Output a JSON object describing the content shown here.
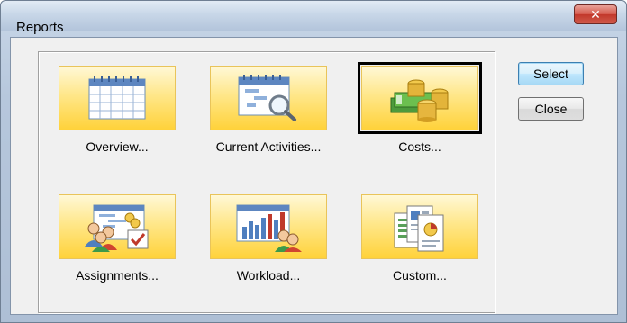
{
  "window": {
    "title": "Reports",
    "close_glyph": "✕"
  },
  "tiles": [
    {
      "label": "Overview...",
      "icon": "calendar-grid-icon"
    },
    {
      "label": "Current Activities...",
      "icon": "calendar-magnifier-icon"
    },
    {
      "label": "Costs...",
      "icon": "money-stacks-icon",
      "selected": true
    },
    {
      "label": "Assignments...",
      "icon": "assignment-people-icon"
    },
    {
      "label": "Workload...",
      "icon": "workload-chart-icon"
    },
    {
      "label": "Custom...",
      "icon": "documents-icon"
    }
  ],
  "buttons": {
    "select": "Select",
    "close": "Close"
  },
  "colors": {
    "tile_gradient_top": "#fff8d6",
    "tile_gradient_bottom": "#ffd23a",
    "default_button_border": "#3c7fb1",
    "close_button": "#c2382b"
  }
}
